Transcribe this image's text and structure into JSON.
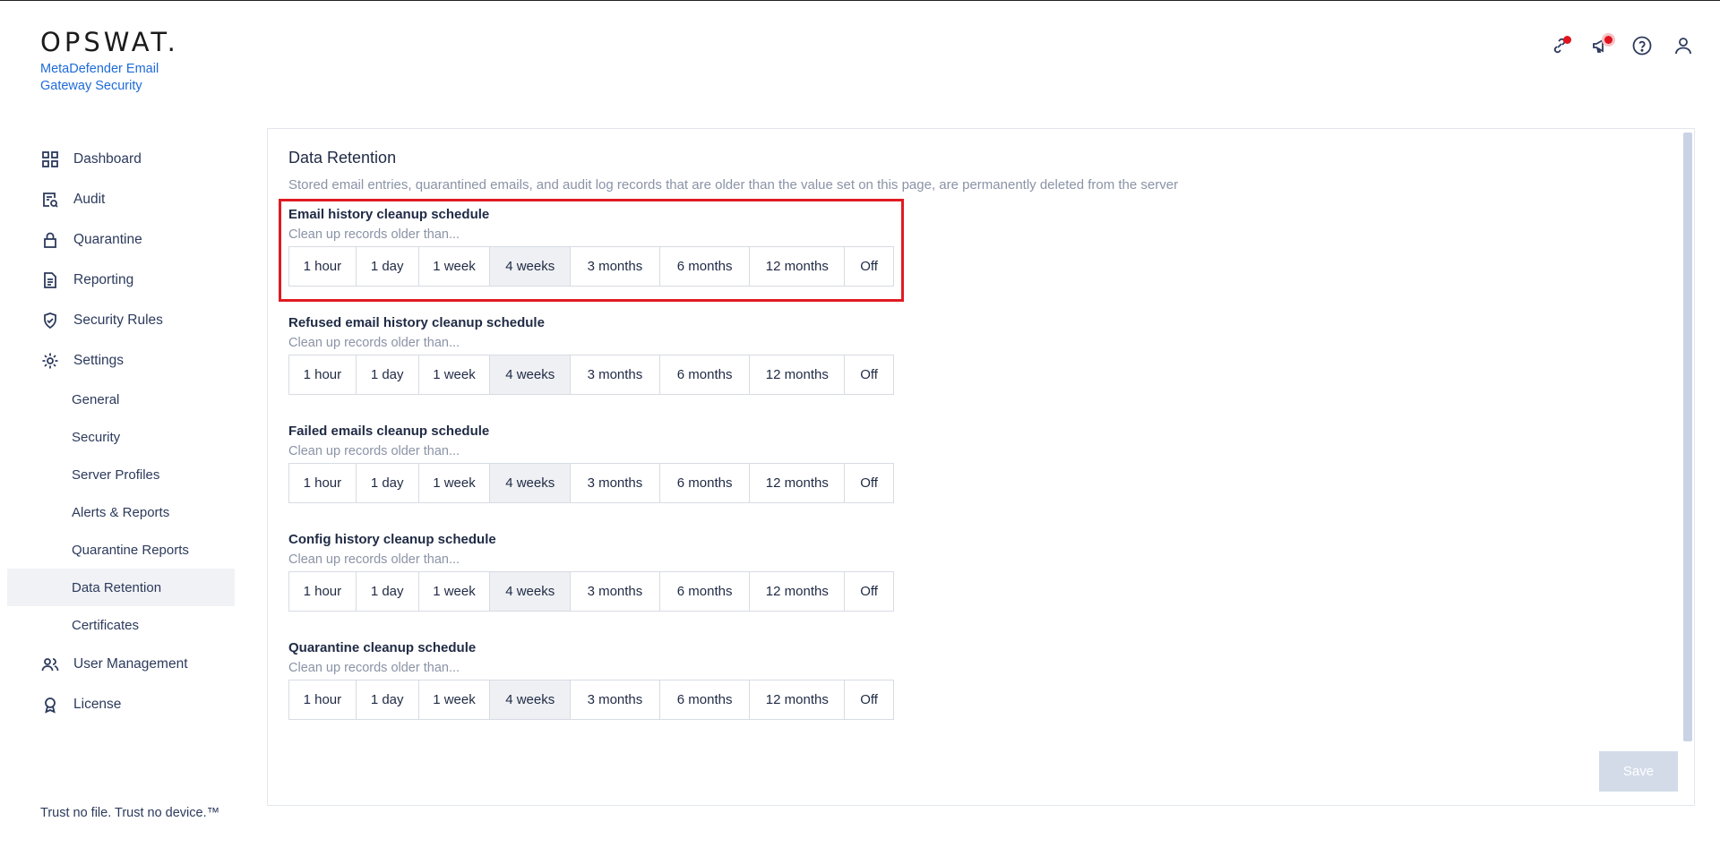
{
  "brand": {
    "logo_text": "OPSWAT.",
    "product_name": "MetaDefender Email Gateway Security",
    "tagline": "Trust no file. Trust no device.™"
  },
  "nav": {
    "items": [
      {
        "label": "Dashboard",
        "icon": "dashboard-grid-icon"
      },
      {
        "label": "Audit",
        "icon": "audit-icon"
      },
      {
        "label": "Quarantine",
        "icon": "lock-icon"
      },
      {
        "label": "Reporting",
        "icon": "document-icon"
      },
      {
        "label": "Security Rules",
        "icon": "shield-check-icon"
      },
      {
        "label": "Settings",
        "icon": "gear-icon"
      }
    ],
    "settings_sub": [
      "General",
      "Security",
      "Server Profiles",
      "Alerts & Reports",
      "Quarantine Reports",
      "Data Retention",
      "Certificates"
    ],
    "active_sub": "Data Retention",
    "bottom_items": [
      {
        "label": "User Management",
        "icon": "users-icon"
      },
      {
        "label": "License",
        "icon": "award-icon"
      }
    ]
  },
  "topbar": {
    "icons": [
      "link-icon",
      "megaphone-icon",
      "help-icon",
      "user-icon"
    ]
  },
  "page": {
    "title": "Data Retention",
    "description": "Stored email entries, quarantined emails, and audit log records that are older than the value set on this page, are permanently deleted from the server",
    "options": [
      "1 hour",
      "1 day",
      "1 week",
      "4 weeks",
      "3 months",
      "6 months",
      "12 months",
      "Off"
    ],
    "sections": [
      {
        "title": "Email history cleanup schedule",
        "subtitle": "Clean up records older than...",
        "selected": "4 weeks"
      },
      {
        "title": "Refused email history cleanup schedule",
        "subtitle": "Clean up records older than...",
        "selected": "4 weeks"
      },
      {
        "title": "Failed emails cleanup schedule",
        "subtitle": "Clean up records older than...",
        "selected": "4 weeks"
      },
      {
        "title": "Config history cleanup schedule",
        "subtitle": "Clean up records older than...",
        "selected": "4 weeks"
      },
      {
        "title": "Quarantine cleanup schedule",
        "subtitle": "Clean up records older than...",
        "selected": "4 weeks"
      }
    ],
    "save_label": "Save"
  },
  "colors": {
    "accent_blue": "#1d6bd8",
    "highlight_red": "#e01b22",
    "notification_red": "#e0141e",
    "save_disabled": "#d3dbe9"
  }
}
